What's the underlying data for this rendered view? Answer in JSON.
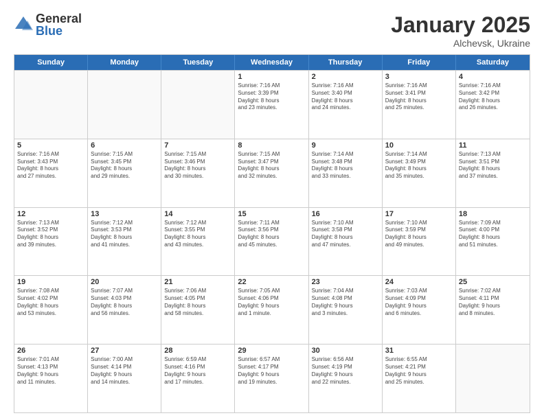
{
  "logo": {
    "general": "General",
    "blue": "Blue"
  },
  "title": "January 2025",
  "location": "Alchevsk, Ukraine",
  "header_days": [
    "Sunday",
    "Monday",
    "Tuesday",
    "Wednesday",
    "Thursday",
    "Friday",
    "Saturday"
  ],
  "weeks": [
    [
      {
        "day": "",
        "info": "",
        "empty": true
      },
      {
        "day": "",
        "info": "",
        "empty": true
      },
      {
        "day": "",
        "info": "",
        "empty": true
      },
      {
        "day": "1",
        "info": "Sunrise: 7:16 AM\nSunset: 3:39 PM\nDaylight: 8 hours\nand 23 minutes."
      },
      {
        "day": "2",
        "info": "Sunrise: 7:16 AM\nSunset: 3:40 PM\nDaylight: 8 hours\nand 24 minutes."
      },
      {
        "day": "3",
        "info": "Sunrise: 7:16 AM\nSunset: 3:41 PM\nDaylight: 8 hours\nand 25 minutes."
      },
      {
        "day": "4",
        "info": "Sunrise: 7:16 AM\nSunset: 3:42 PM\nDaylight: 8 hours\nand 26 minutes."
      }
    ],
    [
      {
        "day": "5",
        "info": "Sunrise: 7:16 AM\nSunset: 3:43 PM\nDaylight: 8 hours\nand 27 minutes."
      },
      {
        "day": "6",
        "info": "Sunrise: 7:15 AM\nSunset: 3:45 PM\nDaylight: 8 hours\nand 29 minutes."
      },
      {
        "day": "7",
        "info": "Sunrise: 7:15 AM\nSunset: 3:46 PM\nDaylight: 8 hours\nand 30 minutes."
      },
      {
        "day": "8",
        "info": "Sunrise: 7:15 AM\nSunset: 3:47 PM\nDaylight: 8 hours\nand 32 minutes."
      },
      {
        "day": "9",
        "info": "Sunrise: 7:14 AM\nSunset: 3:48 PM\nDaylight: 8 hours\nand 33 minutes."
      },
      {
        "day": "10",
        "info": "Sunrise: 7:14 AM\nSunset: 3:49 PM\nDaylight: 8 hours\nand 35 minutes."
      },
      {
        "day": "11",
        "info": "Sunrise: 7:13 AM\nSunset: 3:51 PM\nDaylight: 8 hours\nand 37 minutes."
      }
    ],
    [
      {
        "day": "12",
        "info": "Sunrise: 7:13 AM\nSunset: 3:52 PM\nDaylight: 8 hours\nand 39 minutes."
      },
      {
        "day": "13",
        "info": "Sunrise: 7:12 AM\nSunset: 3:53 PM\nDaylight: 8 hours\nand 41 minutes."
      },
      {
        "day": "14",
        "info": "Sunrise: 7:12 AM\nSunset: 3:55 PM\nDaylight: 8 hours\nand 43 minutes."
      },
      {
        "day": "15",
        "info": "Sunrise: 7:11 AM\nSunset: 3:56 PM\nDaylight: 8 hours\nand 45 minutes."
      },
      {
        "day": "16",
        "info": "Sunrise: 7:10 AM\nSunset: 3:58 PM\nDaylight: 8 hours\nand 47 minutes."
      },
      {
        "day": "17",
        "info": "Sunrise: 7:10 AM\nSunset: 3:59 PM\nDaylight: 8 hours\nand 49 minutes."
      },
      {
        "day": "18",
        "info": "Sunrise: 7:09 AM\nSunset: 4:00 PM\nDaylight: 8 hours\nand 51 minutes."
      }
    ],
    [
      {
        "day": "19",
        "info": "Sunrise: 7:08 AM\nSunset: 4:02 PM\nDaylight: 8 hours\nand 53 minutes."
      },
      {
        "day": "20",
        "info": "Sunrise: 7:07 AM\nSunset: 4:03 PM\nDaylight: 8 hours\nand 56 minutes."
      },
      {
        "day": "21",
        "info": "Sunrise: 7:06 AM\nSunset: 4:05 PM\nDaylight: 8 hours\nand 58 minutes."
      },
      {
        "day": "22",
        "info": "Sunrise: 7:05 AM\nSunset: 4:06 PM\nDaylight: 9 hours\nand 1 minute."
      },
      {
        "day": "23",
        "info": "Sunrise: 7:04 AM\nSunset: 4:08 PM\nDaylight: 9 hours\nand 3 minutes."
      },
      {
        "day": "24",
        "info": "Sunrise: 7:03 AM\nSunset: 4:09 PM\nDaylight: 9 hours\nand 6 minutes."
      },
      {
        "day": "25",
        "info": "Sunrise: 7:02 AM\nSunset: 4:11 PM\nDaylight: 9 hours\nand 8 minutes."
      }
    ],
    [
      {
        "day": "26",
        "info": "Sunrise: 7:01 AM\nSunset: 4:13 PM\nDaylight: 9 hours\nand 11 minutes."
      },
      {
        "day": "27",
        "info": "Sunrise: 7:00 AM\nSunset: 4:14 PM\nDaylight: 9 hours\nand 14 minutes."
      },
      {
        "day": "28",
        "info": "Sunrise: 6:59 AM\nSunset: 4:16 PM\nDaylight: 9 hours\nand 17 minutes."
      },
      {
        "day": "29",
        "info": "Sunrise: 6:57 AM\nSunset: 4:17 PM\nDaylight: 9 hours\nand 19 minutes."
      },
      {
        "day": "30",
        "info": "Sunrise: 6:56 AM\nSunset: 4:19 PM\nDaylight: 9 hours\nand 22 minutes."
      },
      {
        "day": "31",
        "info": "Sunrise: 6:55 AM\nSunset: 4:21 PM\nDaylight: 9 hours\nand 25 minutes."
      },
      {
        "day": "",
        "info": "",
        "empty": true
      }
    ]
  ]
}
